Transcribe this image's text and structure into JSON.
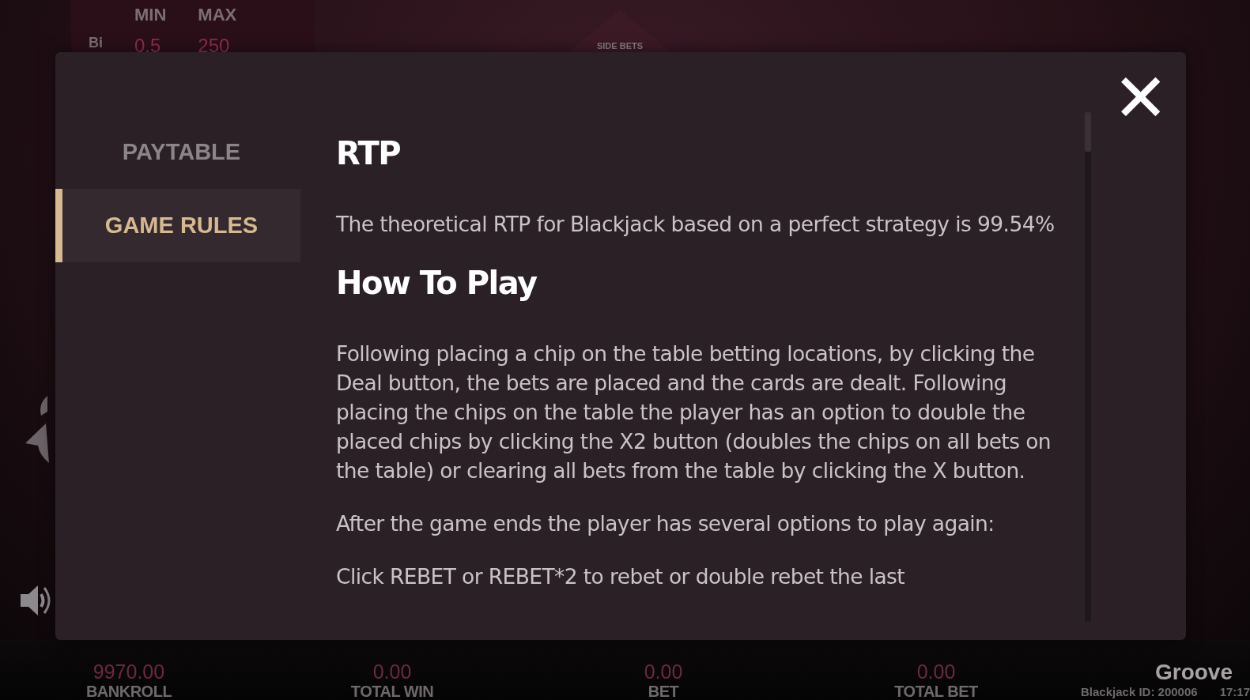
{
  "table_limits": {
    "headers": [
      "MIN",
      "MAX"
    ],
    "row_label": "Bi",
    "values": [
      "0.5",
      "250"
    ]
  },
  "side_bets_label": "SIDE BETS",
  "dialog": {
    "close_label": "✕",
    "nav": [
      {
        "label": "PAYTABLE",
        "selected": false
      },
      {
        "label": "GAME RULES",
        "selected": true
      }
    ],
    "sections": [
      {
        "heading": "RTP",
        "paragraphs": [
          "The theoretical RTP for Blackjack based on a perfect strategy is 99.54%"
        ]
      },
      {
        "heading": "How To Play",
        "paragraphs": [
          "Following placing a chip on the table betting locations, by clicking the Deal button, the bets are placed and the cards are dealt. Following placing the chips on the table the player has an option to double the placed chips by clicking the X2 button (doubles the chips on all bets on the table) or clearing all bets from the table by clicking the X button.",
          "After the game ends the player has several options to play again:",
          "Click REBET or REBET*2 to rebet or double rebet the last"
        ]
      }
    ]
  },
  "bottom_bar": {
    "stats": [
      {
        "value": "9970.00",
        "label": "BANKROLL"
      },
      {
        "value": "0.00",
        "label": "TOTAL WIN"
      },
      {
        "value": "0.00",
        "label": "BET"
      },
      {
        "value": "0.00",
        "label": "TOTAL BET"
      }
    ],
    "brand": "Groove",
    "game_id": "Blackjack ID: 200006",
    "time": "17:17"
  }
}
